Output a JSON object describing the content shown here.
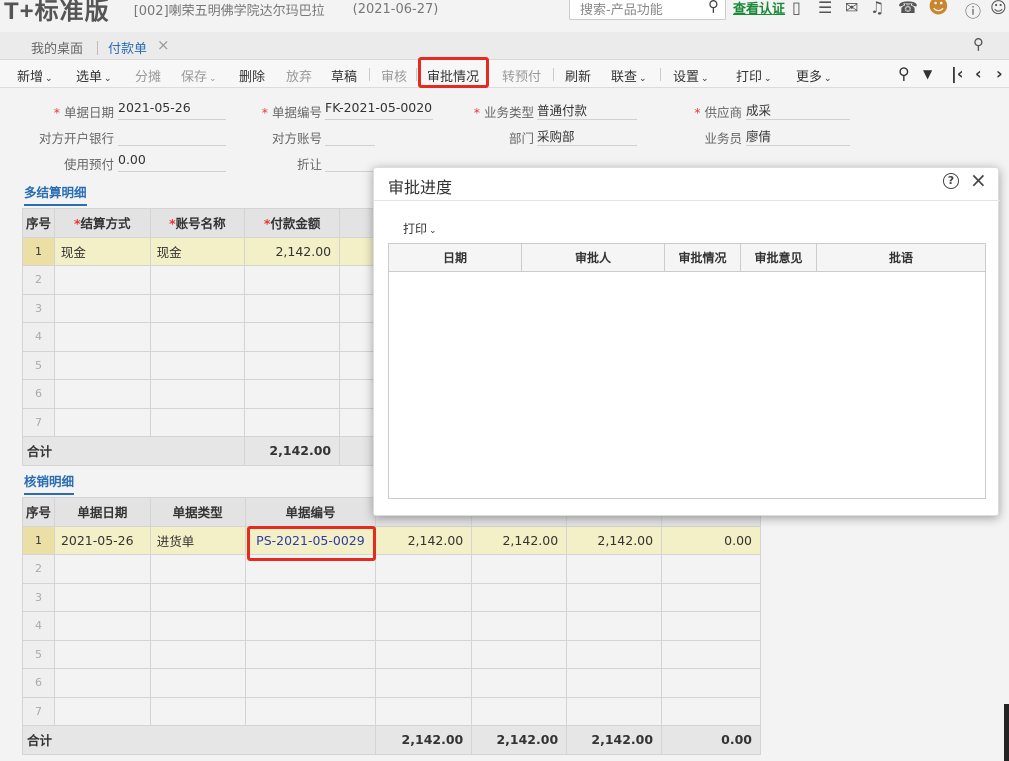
{
  "titlebar": {
    "logo": "T+标准版",
    "company": "[002]喇荣五明佛学院达尔玛巴拉",
    "date": "(2021-06-27)",
    "search_placeholder": "搜索-产品功能",
    "cert_link": "查看认证"
  },
  "tabs": {
    "home": "我的桌面",
    "active": "付款单"
  },
  "toolbar": {
    "new": "新增",
    "pick": "选单",
    "split": "分摊",
    "save": "保存",
    "delete": "删除",
    "discard": "放弃",
    "draft": "草稿",
    "audit": "审核",
    "approval_status": "审批情况",
    "prepay": "转预付",
    "refresh": "刷新",
    "link_query": "联查",
    "settings": "设置",
    "print": "打印",
    "more": "更多"
  },
  "form": {
    "doc_date_label": "单据日期",
    "doc_date": "2021-05-26",
    "doc_no_label": "单据编号",
    "doc_no": "FK-2021-05-0020",
    "biz_type_label": "业务类型",
    "biz_type": "普通付款",
    "supplier_label": "供应商",
    "supplier": "成采",
    "bank_label": "对方开户银行",
    "bank": "",
    "account_label": "对方账号",
    "account": "",
    "dept_label": "部门",
    "dept": "采购部",
    "salesman_label": "业务员",
    "salesman": "廖倩",
    "prepay_used_label": "使用预付",
    "prepay_used": "0.00",
    "discount_label": "折让",
    "discount": ""
  },
  "settlement": {
    "title": "多结算明细",
    "headers": [
      "序号",
      "结算方式",
      "账号名称",
      "付款金额"
    ],
    "rows": [
      {
        "idx": "1",
        "method": "现金",
        "account": "现金",
        "amount": "2,142.00"
      },
      {
        "idx": "2",
        "method": "",
        "account": "",
        "amount": ""
      },
      {
        "idx": "3",
        "method": "",
        "account": "",
        "amount": ""
      },
      {
        "idx": "4",
        "method": "",
        "account": "",
        "amount": ""
      },
      {
        "idx": "5",
        "method": "",
        "account": "",
        "amount": ""
      },
      {
        "idx": "6",
        "method": "",
        "account": "",
        "amount": ""
      },
      {
        "idx": "7",
        "method": "",
        "account": "",
        "amount": ""
      }
    ],
    "total_label": "合计",
    "total_amount": "2,142.00"
  },
  "writeoff": {
    "title": "核销明细",
    "headers": [
      "序号",
      "单据日期",
      "单据类型",
      "单据编号"
    ],
    "rows": [
      {
        "idx": "1",
        "date": "2021-05-26",
        "type": "进货单",
        "no": "PS-2021-05-0029",
        "c1": "2,142.00",
        "c2": "2,142.00",
        "c3": "2,142.00",
        "c4": "0.00"
      },
      {
        "idx": "2",
        "date": "",
        "type": "",
        "no": "",
        "c1": "",
        "c2": "",
        "c3": "",
        "c4": ""
      },
      {
        "idx": "3",
        "date": "",
        "type": "",
        "no": "",
        "c1": "",
        "c2": "",
        "c3": "",
        "c4": ""
      },
      {
        "idx": "4",
        "date": "",
        "type": "",
        "no": "",
        "c1": "",
        "c2": "",
        "c3": "",
        "c4": ""
      },
      {
        "idx": "5",
        "date": "",
        "type": "",
        "no": "",
        "c1": "",
        "c2": "",
        "c3": "",
        "c4": ""
      },
      {
        "idx": "6",
        "date": "",
        "type": "",
        "no": "",
        "c1": "",
        "c2": "",
        "c3": "",
        "c4": ""
      },
      {
        "idx": "7",
        "date": "",
        "type": "",
        "no": "",
        "c1": "",
        "c2": "",
        "c3": "",
        "c4": ""
      }
    ],
    "total_label": "合计",
    "totals": [
      "2,142.00",
      "2,142.00",
      "2,142.00",
      "0.00"
    ]
  },
  "modal": {
    "title": "审批进度",
    "print": "打印",
    "headers": [
      "日期",
      "审批人",
      "审批情况",
      "审批意见",
      "批语"
    ]
  },
  "colors": {
    "accent": "#2b6db3",
    "highlight": "#e62a1f",
    "selected_row": "#f3efc6",
    "link": "#2f3ca8"
  }
}
